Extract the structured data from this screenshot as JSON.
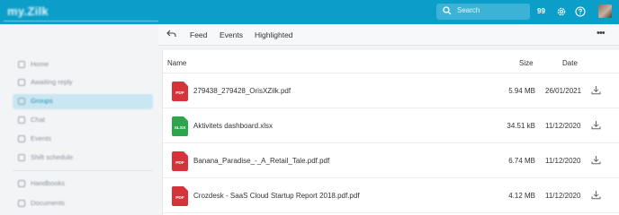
{
  "app": {
    "logo": "my.Zilk"
  },
  "topbar": {
    "search_placeholder": "Search",
    "notification_count": "99"
  },
  "sidebar": {
    "items": [
      {
        "label": "Home",
        "icon": "home-icon"
      },
      {
        "label": "Awaiting reply",
        "icon": "reply-icon"
      },
      {
        "label": "Groups",
        "icon": "groups-icon",
        "active": true
      },
      {
        "label": "Chat",
        "icon": "chat-icon"
      },
      {
        "label": "Events",
        "icon": "calendar-icon"
      },
      {
        "label": "Shift schedule",
        "icon": "schedule-icon"
      },
      {
        "label": "Handbooks",
        "icon": "book-icon"
      },
      {
        "label": "Documents",
        "icon": "document-icon"
      }
    ]
  },
  "toolbar": {
    "tabs": [
      "Feed",
      "Events",
      "Highlighted"
    ]
  },
  "files": {
    "columns": {
      "name": "Name",
      "size": "Size",
      "date": "Date"
    },
    "rows": [
      {
        "type": "PDF",
        "name": "279438_279428_OrisXZilk.pdf",
        "size": "5.94 MB",
        "date": "26/01/2021"
      },
      {
        "type": "XLSX",
        "name": "Aktivitets dashboard.xlsx",
        "size": "34.51 kB",
        "date": "11/12/2020"
      },
      {
        "type": "PDF",
        "name": "Banana_Paradise_-_A_Retail_Tale.pdf.pdf",
        "size": "6.74 MB",
        "date": "11/12/2020"
      },
      {
        "type": "PDF",
        "name": "Crozdesk - SaaS Cloud Startup Report 2018.pdf.pdf",
        "size": "4.12 MB",
        "date": "11/12/2020"
      }
    ]
  },
  "colors": {
    "topbar": "#0a9ec9",
    "pdf": "#d6323a",
    "xlsx": "#2da54b",
    "active_nav": "#c9e7f2"
  }
}
